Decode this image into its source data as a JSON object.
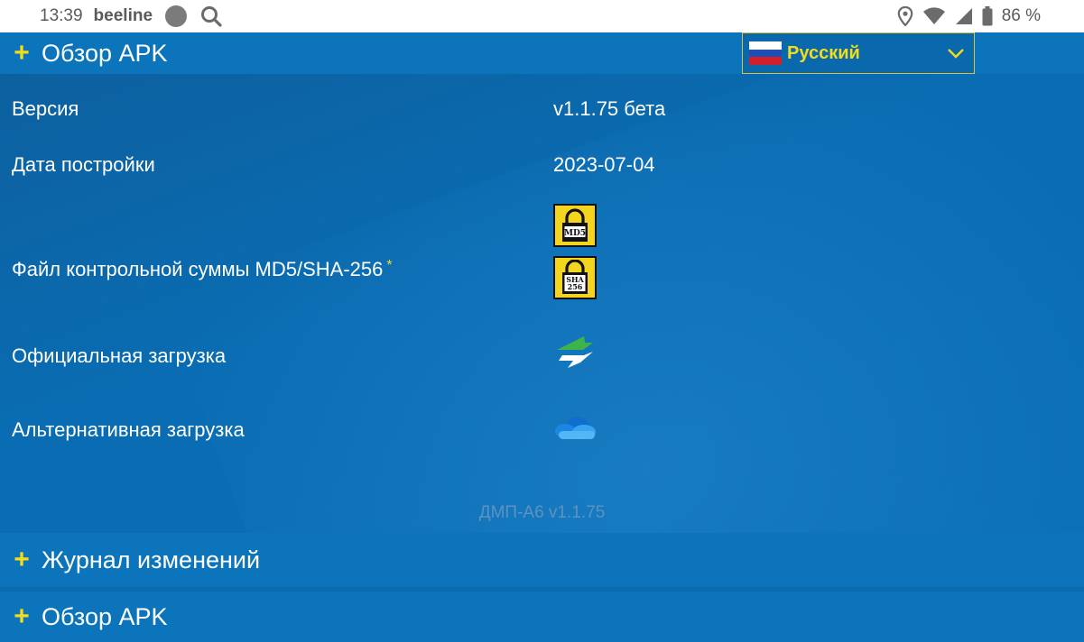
{
  "status_bar": {
    "time": "13:39",
    "carrier": "beeline",
    "battery": "86 %",
    "icons": [
      "notification-dot-icon",
      "search-icon",
      "location-icon",
      "wifi-icon",
      "signal-icon",
      "battery-icon"
    ]
  },
  "overview": {
    "header": "Обзор APK",
    "language": "Русский",
    "rows": {
      "version_label": "Версия",
      "version_value": "v1.1.75 бета",
      "build_date_label": "Дата постройки",
      "build_date_value": "2023-07-04",
      "checksum_label": "Файл контрольной суммы MD5/SHA-256",
      "checksum_marker": "*",
      "md5_badge": "MD5",
      "sha_badge_line1": "SHA",
      "sha_badge_line2": "256",
      "official_download_label": "Официальная загрузка",
      "alt_download_label": "Альтернативная загрузка"
    },
    "footer_version": "ДМП-А6 v1.1.75"
  },
  "accordion": [
    {
      "label": "Журнал изменений"
    },
    {
      "label": "Обзор APK"
    }
  ],
  "colors": {
    "accent_yellow": "#f2dc1c",
    "panel_blue": "#0a6bb0",
    "header_blue": "#0b74bb"
  }
}
